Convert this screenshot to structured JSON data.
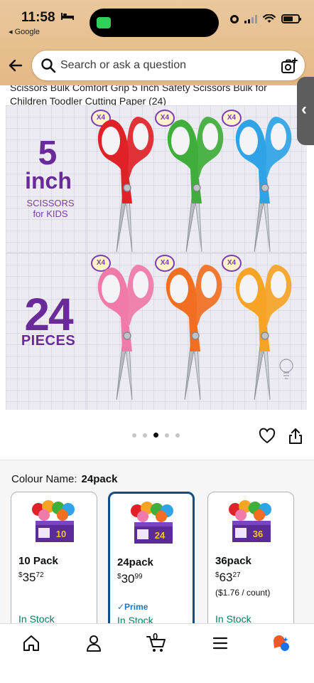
{
  "status_bar": {
    "time": "11:58",
    "back_app": "◂ Google"
  },
  "search": {
    "placeholder": "Search or ask a question"
  },
  "product": {
    "title_line1": "Scissors Bulk Comfort Grip 5 Inch Safety Scissors Bulk for",
    "title_line2": "Children Toodler Cutting Paper (24)",
    "image": {
      "size_number": "5",
      "size_unit": "inch",
      "subtitle_line1": "SCISSORS",
      "subtitle_line2": "for KIDS",
      "count_number": "24",
      "count_label": "PIECES",
      "badge": "X4",
      "scissor_colors": [
        "#e02228",
        "#3fae3a",
        "#2fa3e6",
        "#f07aa8",
        "#f26f22",
        "#f7a325"
      ]
    },
    "carousel": {
      "total_dots": 5,
      "active_dot": 2
    }
  },
  "variation": {
    "label": "Colour Name:",
    "selected": "24pack",
    "options": [
      {
        "name": "10 Pack",
        "price_main": "35",
        "price_cents": "72",
        "unit_price": "",
        "prime": "",
        "stock": "In Stock",
        "box_text": "10"
      },
      {
        "name": "24pack",
        "price_main": "30",
        "price_cents": "99",
        "unit_price": "",
        "prime": "✓Prime",
        "stock": "In Stock",
        "box_text": "24"
      },
      {
        "name": "36pack",
        "price_main": "63",
        "price_cents": "27",
        "unit_price": "($1.76 / count)",
        "prime": "",
        "stock": "In Stock",
        "box_text": "36"
      }
    ]
  },
  "tabbar": {
    "cart_count": "0",
    "items": [
      "home-icon",
      "account-icon",
      "cart-icon",
      "menu-icon",
      "rufus-assistant-icon"
    ]
  },
  "colors": {
    "header_bg": "#e5b886",
    "brand_purple": "#6a2a9a",
    "selected_border": "#0f4e86",
    "in_stock": "#067d62",
    "prime_blue": "#1a73c6"
  }
}
